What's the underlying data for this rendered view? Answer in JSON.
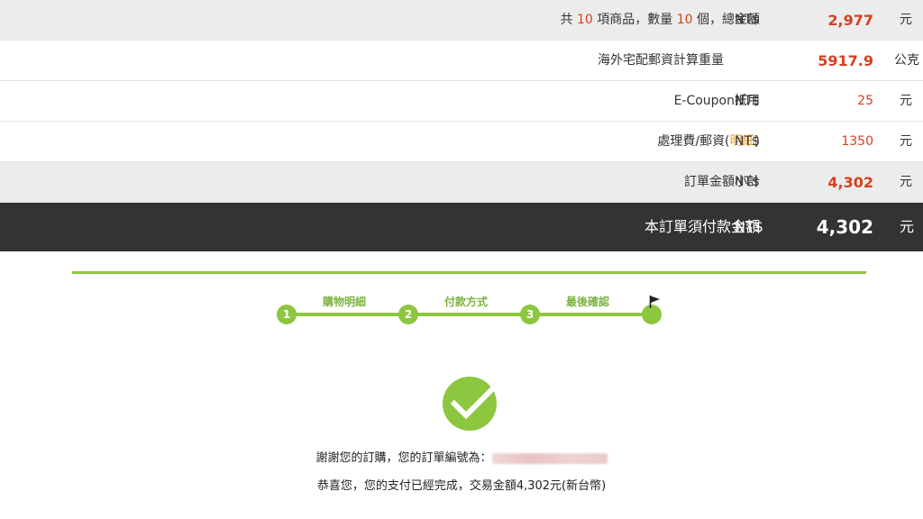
{
  "summary": {
    "items_row": {
      "prefix": "共",
      "item_count": "10",
      "middle": "項商品，數量",
      "quantity": "10",
      "suffix": "個，總金額",
      "currency": "NT$",
      "value": "2,977",
      "unit": "元"
    },
    "weight_row": {
      "label": "海外宅配郵資計算重量",
      "value": "5917.9",
      "unit": "公克"
    },
    "coupon_row": {
      "label": "E-Coupon抵用",
      "currency": "NT$",
      "value": "25",
      "unit": "元"
    },
    "fee_row": {
      "label_prefix": "處理費/郵資(",
      "link": "明細",
      "label_suffix": ")",
      "currency": "NT$",
      "value": "1350",
      "unit": "元"
    },
    "subtotal_row": {
      "label": "訂單金額小計",
      "currency": "NT$",
      "value": "4,302",
      "unit": "元"
    },
    "total_row": {
      "label": "本訂單須付款金額",
      "currency": "NT$",
      "value": "4,302",
      "unit": "元"
    }
  },
  "steps": [
    {
      "number": "1",
      "label": "購物明細"
    },
    {
      "number": "2",
      "label": "付款方式"
    },
    {
      "number": "3",
      "label": "最後確認"
    }
  ],
  "icons": {
    "flag": "flag-icon",
    "success": "checkmark-circle-icon"
  },
  "colors": {
    "accent_green": "#8dc63f",
    "price_red": "#d6401c",
    "link_orange": "#e39a2c",
    "total_bar": "#333333"
  },
  "messages": {
    "thanks": "謝謝您的訂購，您的訂單編號為：",
    "paid": "恭喜您，您的支付已經完成，交易金額4,302元(新台幣)"
  }
}
